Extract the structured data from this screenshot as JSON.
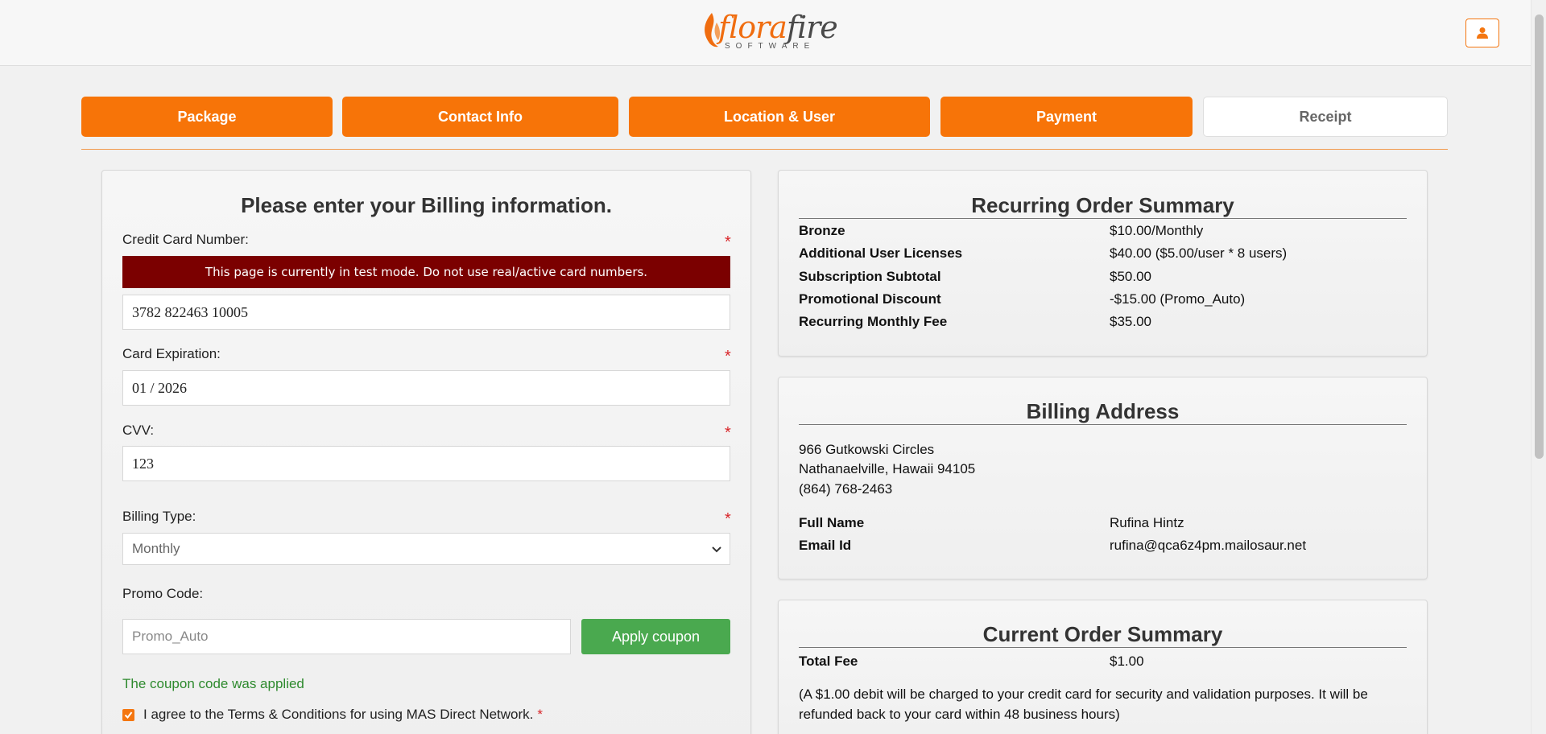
{
  "header": {
    "logo_word_1": "flora",
    "logo_word_2": "fire",
    "logo_sub": "SOFTWARE",
    "user_icon": "user-icon"
  },
  "steps": [
    {
      "label": "Package",
      "state": "complete"
    },
    {
      "label": "Contact Info",
      "state": "complete"
    },
    {
      "label": "Location & User",
      "state": "complete"
    },
    {
      "label": "Payment",
      "state": "active"
    },
    {
      "label": "Receipt",
      "state": "inactive"
    }
  ],
  "billing": {
    "title": "Please enter your Billing information.",
    "card_number_label": "Credit Card Number:",
    "test_mode_banner": "This page is currently in test mode. Do not use real/active card numbers.",
    "card_number_value": "3782 822463 10005",
    "expiration_label": "Card Expiration:",
    "expiration_value": "01 / 2026",
    "cvv_label": "CVV:",
    "cvv_value": "123",
    "billing_type_label": "Billing Type:",
    "billing_type_value": "Monthly",
    "promo_label": "Promo Code:",
    "promo_value": "Promo_Auto",
    "apply_button": "Apply coupon",
    "coupon_message": "The coupon code was applied",
    "agree_text": "I agree to the Terms & Conditions for using MAS Direct Network.",
    "required_marker": "*"
  },
  "recurring_summary": {
    "title": "Recurring Order Summary",
    "rows": [
      {
        "key": "Bronze",
        "value": "$10.00/Monthly"
      },
      {
        "key": "Additional User Licenses",
        "value": "$40.00 ($5.00/user * 8 users)"
      },
      {
        "key": "Subscription Subtotal",
        "value": "$50.00"
      },
      {
        "key": "Promotional Discount",
        "value": "-$15.00 (Promo_Auto)"
      },
      {
        "key": "Recurring Monthly Fee",
        "value": "$35.00"
      }
    ]
  },
  "billing_address": {
    "title": "Billing Address",
    "line1": "966 Gutkowski Circles",
    "line2": "Nathanaelville, Hawaii 94105",
    "phone": "(864) 768-2463",
    "rows": [
      {
        "key": "Full Name",
        "value": "Rufina Hintz"
      },
      {
        "key": "Email Id",
        "value": "rufina@qca6z4pm.mailosaur.net"
      }
    ]
  },
  "current_summary": {
    "title": "Current Order Summary",
    "rows": [
      {
        "key": "Total Fee",
        "value": "$1.00"
      }
    ],
    "note": "(A $1.00 debit will be charged to your credit card for security and validation purposes. It will be refunded back to your card within 48 business hours)"
  },
  "colors": {
    "accent": "#f77408",
    "banner": "#7b0000",
    "apply": "#4aa94f",
    "success": "#2e8a2e"
  }
}
